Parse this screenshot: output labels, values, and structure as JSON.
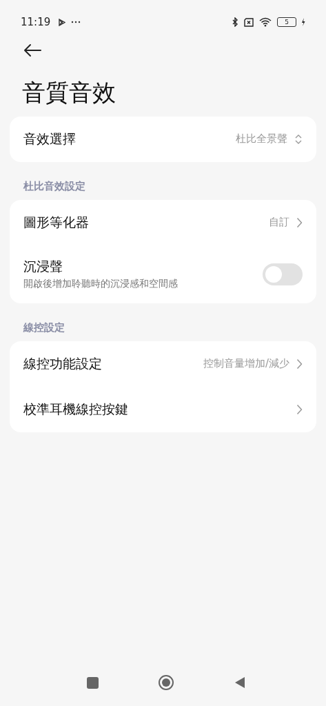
{
  "status_bar": {
    "time": "11:19",
    "battery": "5"
  },
  "title": "音質音效",
  "groups": [
    {
      "items": [
        {
          "kind": "select",
          "label": "音效選擇",
          "value": "杜比全景聲"
        }
      ]
    },
    {
      "header": "杜比音效設定",
      "items": [
        {
          "kind": "link",
          "label": "圖形等化器",
          "value": "自訂"
        },
        {
          "kind": "toggle",
          "label": "沉浸聲",
          "subtitle": "開啟後增加聆聽時的沉浸感和空間感",
          "on": false
        }
      ]
    },
    {
      "header": "線控設定",
      "items": [
        {
          "kind": "link",
          "label": "線控功能設定",
          "value": "控制音量增加/減少"
        },
        {
          "kind": "link",
          "label": "校準耳機線控按鍵"
        }
      ]
    }
  ]
}
